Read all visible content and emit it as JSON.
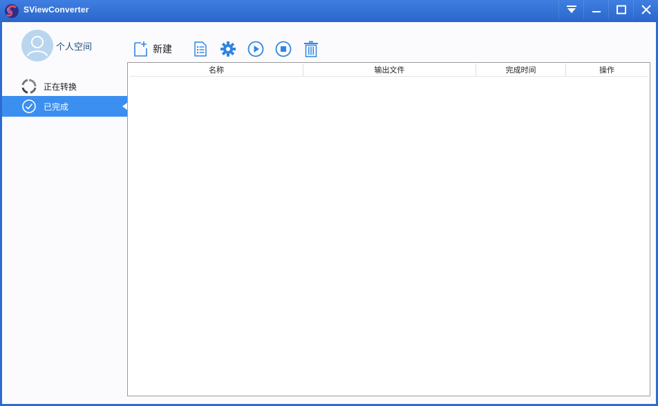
{
  "window": {
    "title": "SViewConverter"
  },
  "sidebar": {
    "profile_label": "个人空间",
    "items": [
      {
        "label": "正在转换",
        "icon": "converting-spinner-icon",
        "selected": false
      },
      {
        "label": "已完成",
        "icon": "check-circle-icon",
        "selected": true
      }
    ]
  },
  "toolbar": {
    "new_label": "新建",
    "buttons": [
      "new-file-icon",
      "list-icon",
      "gear-icon",
      "play-icon",
      "stop-icon",
      "trash-icon"
    ]
  },
  "table": {
    "columns": [
      "名称",
      "输出文件",
      "完成时间",
      "操作"
    ],
    "rows": []
  },
  "colors": {
    "titlebar": "#2e6bd0",
    "selected_item": "#3b8ff0",
    "icon_blue": "#2f86e0"
  }
}
